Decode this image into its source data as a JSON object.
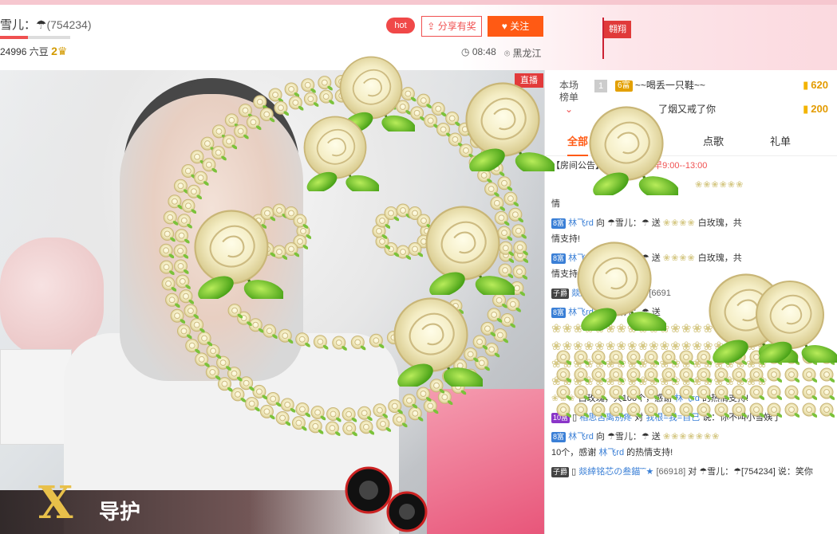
{
  "header": {
    "anchor_name": "雪儿：",
    "anchor_icon": "umbrella-icon",
    "room_id": "(754234)",
    "beans": "24996 六豆",
    "crown_level": "2",
    "level_progress": 0.4,
    "hot_label": "hot",
    "share_label": "分享有奖",
    "follow_label": "关注",
    "live_time": "08:48",
    "location": "黑龙江",
    "flag_label": "翱翔"
  },
  "video": {
    "live_badge": "直播",
    "guard_label": "导护",
    "guard_x": "X"
  },
  "rank": {
    "tab_line1": "本场",
    "tab_line2": "榜单",
    "rows": [
      {
        "num": "1",
        "level": "6富",
        "name": "~~喝丢一只鞋~~",
        "coins": "620"
      },
      {
        "num": "",
        "level": "",
        "name": "了烟又戒了你",
        "coins": "200"
      }
    ]
  },
  "tabs": [
    "全部",
    "点歌",
    "礼单"
  ],
  "chat": {
    "notice_label": "【房间公告】",
    "notice_time": "早9:00--13:00",
    "line_qing": "情",
    "messages": [
      {
        "tag": "8富",
        "from": "林飞rd",
        "verb": "向",
        "to": "雪儿：",
        "action": "送",
        "tail": "白玫瑰，共",
        "tail2": "情支持!"
      },
      {
        "tag": "8富",
        "from": "林飞rd",
        "verb": "向",
        "to": "雪儿：",
        "action": "送",
        "tail": "白玫瑰，共",
        "tail2": "情支持!"
      },
      {
        "tag": "子爵",
        "from": "燚緈铭芯の叁錨˜˜★",
        "room": "[6691",
        "tail": ""
      },
      {
        "tag": "8富",
        "from": "林飞rd",
        "verb": "向",
        "to": "雪儿：",
        "action": "送",
        "tail": ""
      },
      {
        "summary": "白玫瑰，共100个，感谢",
        "thanks_nick": "林飞rd",
        "thanks_tail": "的热情支持!"
      },
      {
        "tag": "10富",
        "from": "相思苦离别疼",
        "verb": "对",
        "to": "我根=我=自己",
        "action": "说：",
        "tail": "你不叫小雪姨了"
      },
      {
        "tag": "8富",
        "from": "林飞rd",
        "verb": "向",
        "to": "雪儿：",
        "action": "送",
        "tail": ""
      },
      {
        "summary": "10个，感谢",
        "thanks_nick": "林飞rd",
        "thanks_tail": "的热情支持!"
      },
      {
        "tag": "子爵",
        "from": "燚緈铭芯の叁錨˜˜★",
        "room": "[66918]",
        "verb": "对",
        "to": "雪儿：",
        "tail": "[754234] 说：笑你"
      }
    ]
  },
  "colors": {
    "accent": "#ff5a14",
    "live_red": "#e23b3b",
    "nick_blue": "#3a7fd6",
    "coin_gold": "#e39b00"
  }
}
